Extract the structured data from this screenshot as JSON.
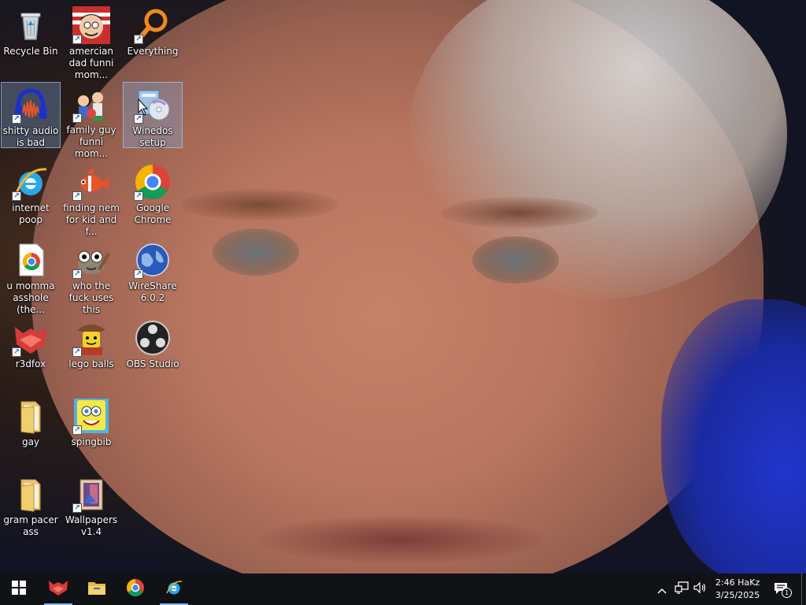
{
  "desktop": {
    "icons": [
      {
        "label": "Recycle Bin",
        "icon": "recycle-bin-icon"
      },
      {
        "label": "amercian dad funni mom...",
        "icon": "american-dad-icon"
      },
      {
        "label": "Everything",
        "icon": "everything-search-icon"
      },
      {
        "label": "shitty audio is bad",
        "icon": "audacity-icon"
      },
      {
        "label": "family guy funni mom...",
        "icon": "family-guy-icon"
      },
      {
        "label": "Winedos setup",
        "icon": "setup-disc-icon"
      },
      {
        "label": "internet poop",
        "icon": "internet-explorer-icon"
      },
      {
        "label": "finding nem for kid and f...",
        "icon": "nemo-fish-icon"
      },
      {
        "label": "Google Chrome",
        "icon": "chrome-icon"
      },
      {
        "label": "u momma asshole (the...",
        "icon": "chrome-document-icon"
      },
      {
        "label": "who the fuck uses this",
        "icon": "gimp-icon"
      },
      {
        "label": "WireShare 6.0.2",
        "icon": "wireshare-globe-icon"
      },
      {
        "label": "r3dfox",
        "icon": "r3dfox-icon"
      },
      {
        "label": "lego balls",
        "icon": "lego-figure-icon"
      },
      {
        "label": "OBS Studio",
        "icon": "obs-icon"
      },
      {
        "label": "gay",
        "icon": "folder-icon"
      },
      {
        "label": "spingbib",
        "icon": "spongebob-icon"
      },
      {
        "label": "gram pacer ass",
        "icon": "folder-icon"
      },
      {
        "label": "Wallpapers v1.4",
        "icon": "wallpapers-icon"
      }
    ]
  },
  "taskbar": {
    "start": "windows-start-icon",
    "pinned": [
      "r3dfox-icon",
      "file-explorer-icon",
      "chrome-icon",
      "internet-explorer-icon"
    ],
    "tray": {
      "time": "2:46 HaKz",
      "date": "3/25/2025",
      "notification_count": "1"
    }
  },
  "colors": {
    "taskbar": "#111216",
    "accent": "#7fb6ff"
  }
}
